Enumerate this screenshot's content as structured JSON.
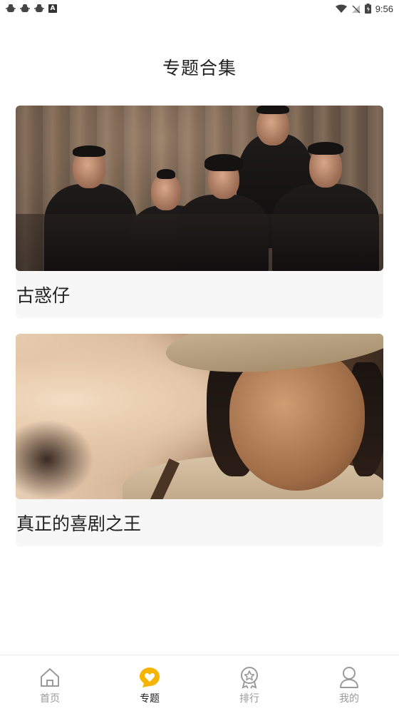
{
  "status_bar": {
    "time": "9:56",
    "a_badge": "A"
  },
  "page": {
    "title": "专题合集"
  },
  "topics": [
    {
      "label": "古惑仔"
    },
    {
      "label": "真正的喜剧之王"
    }
  ],
  "tab_bar": {
    "tabs": [
      {
        "label": "首页",
        "icon": "home-icon",
        "active": false
      },
      {
        "label": "专题",
        "icon": "heart-chat-icon",
        "active": true
      },
      {
        "label": "排行",
        "icon": "medal-icon",
        "active": false
      },
      {
        "label": "我的",
        "icon": "user-icon",
        "active": false
      }
    ],
    "active_color": "#f4b400",
    "inactive_color": "#9a9a9a"
  }
}
